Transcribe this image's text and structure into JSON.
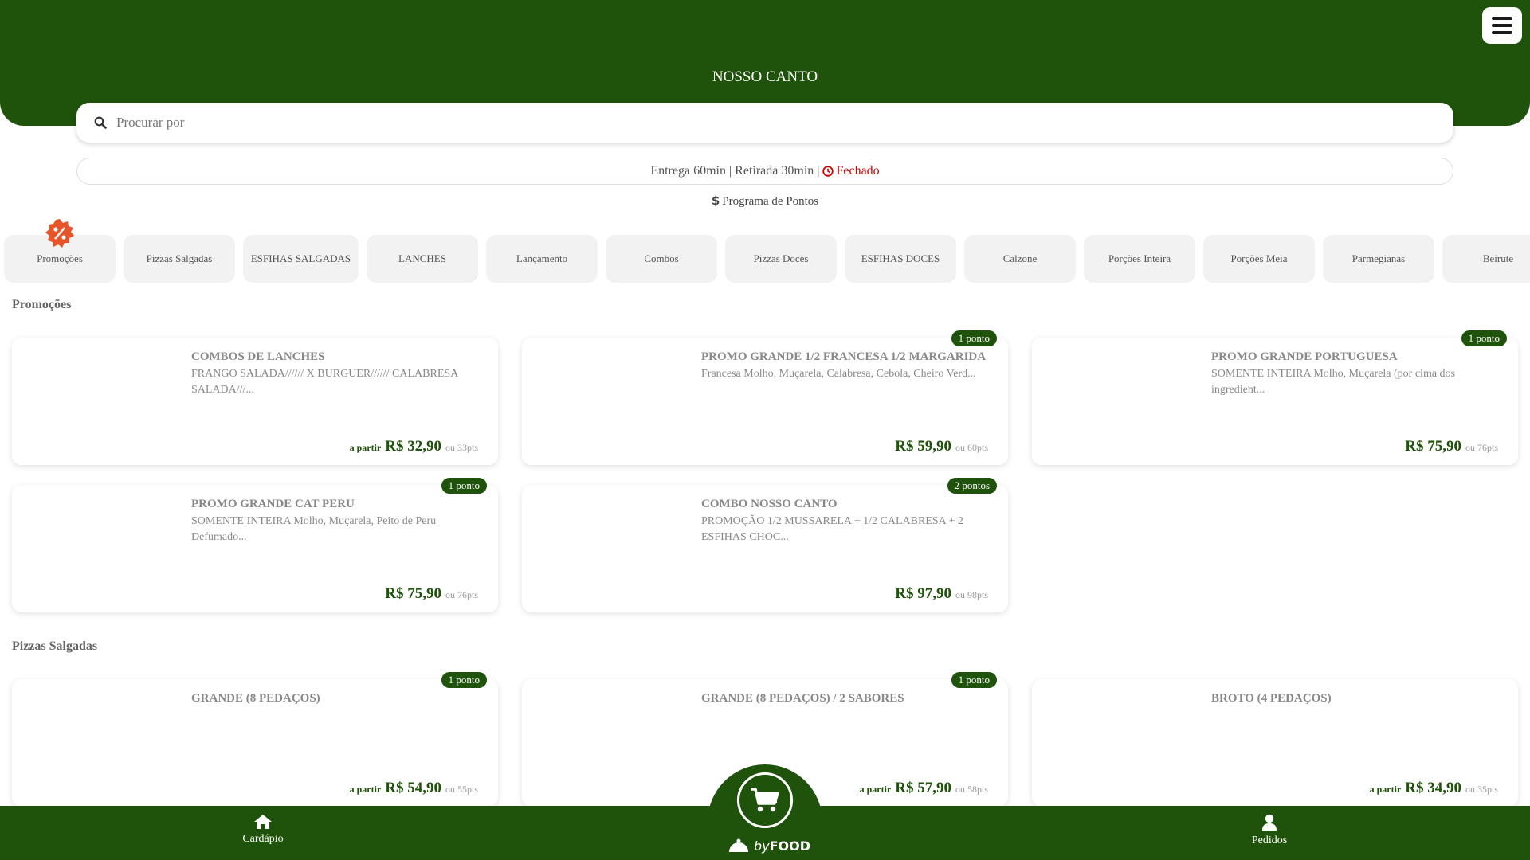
{
  "header": {
    "store_name": "NOSSO CANTO"
  },
  "search": {
    "placeholder": "Procurar por"
  },
  "status": {
    "info": "Entrega 60min | Retirada 30min |",
    "closed_label": "Fechado",
    "closed_color": "#d10000"
  },
  "loyalty": {
    "label": "Programa de Pontos"
  },
  "categories": [
    {
      "label": "Promoções"
    },
    {
      "label": "Pizzas Salgadas"
    },
    {
      "label": "ESFIHAS SALGADAS"
    },
    {
      "label": "LANCHES"
    },
    {
      "label": "Lançamento"
    },
    {
      "label": "Combos"
    },
    {
      "label": "Pizzas Doces"
    },
    {
      "label": "ESFIHAS DOCES"
    },
    {
      "label": "Calzone"
    },
    {
      "label": "Porções Inteira"
    },
    {
      "label": "Porções Meia"
    },
    {
      "label": "Parmegianas"
    },
    {
      "label": "Beirute"
    }
  ],
  "sections": {
    "promos_title": "Promoções",
    "pizzas_title": "Pizzas Salgadas"
  },
  "products": [
    {
      "name": "COMBOS DE LANCHES",
      "desc": "FRANGO SALADA////// X BURGUER////// CALABRESA SALADA///...",
      "from": "a partir",
      "price": "R$ 32,90",
      "pts": "ou 33pts",
      "badge": ""
    },
    {
      "name": "PROMO GRANDE 1/2 FRANCESA 1/2 MARGARIDA",
      "desc": "Francesa Molho, Muçarela, Calabresa, Cebola, Cheiro Verd...",
      "from": "",
      "price": "R$ 59,90",
      "pts": "ou 60pts",
      "badge": "1 ponto"
    },
    {
      "name": "PROMO GRANDE PORTUGUESA",
      "desc": "SOMENTE INTEIRA Molho, Muçarela (por cima dos ingredient...",
      "from": "",
      "price": "R$ 75,90",
      "pts": "ou 76pts",
      "badge": "1 ponto"
    },
    {
      "name": "PROMO GRANDE CAT PERU",
      "desc": "SOMENTE INTEIRA Molho, Muçarela, Peito de Peru Defumado...",
      "from": "",
      "price": "R$ 75,90",
      "pts": "ou 76pts",
      "badge": "1 ponto"
    },
    {
      "name": "COMBO NOSSO CANTO",
      "desc": "PROMOÇÃO 1/2 MUSSARELA + 1/2 CALABRESA + 2 ESFIHAS CHOC...",
      "from": "",
      "price": "R$ 97,90",
      "pts": "ou 98pts",
      "badge": "2 pontos"
    },
    {
      "name": "GRANDE (8 PEDAÇOS)",
      "desc": "",
      "from": "a partir",
      "price": "R$ 54,90",
      "pts": "ou 55pts",
      "badge": "1 ponto"
    },
    {
      "name": "GRANDE (8 PEDAÇOS) / 2 SABORES",
      "desc": "",
      "from": "a partir",
      "price": "R$ 57,90",
      "pts": "ou 58pts",
      "badge": "1 ponto"
    },
    {
      "name": "BROTO (4 PEDAÇOS)",
      "desc": "",
      "from": "a partir",
      "price": "R$ 34,90",
      "pts": "ou 35pts",
      "badge": ""
    }
  ],
  "bottom_nav": {
    "menu_label": "Cardápio",
    "orders_label": "Pedidos",
    "brand_by": "by",
    "brand_name": "FOOD"
  },
  "colors": {
    "brand_green": "#1f520a",
    "chip_bg": "#f2f2f2",
    "promo_badge": "#e8542a"
  },
  "icons": {
    "menu": "hamburger-icon",
    "search": "search-icon",
    "closed": "clock-icon",
    "loyalty": "dollar-icon",
    "promo": "discount-badge-icon",
    "cart": "cart-icon",
    "home": "home-icon",
    "user": "user-icon"
  }
}
